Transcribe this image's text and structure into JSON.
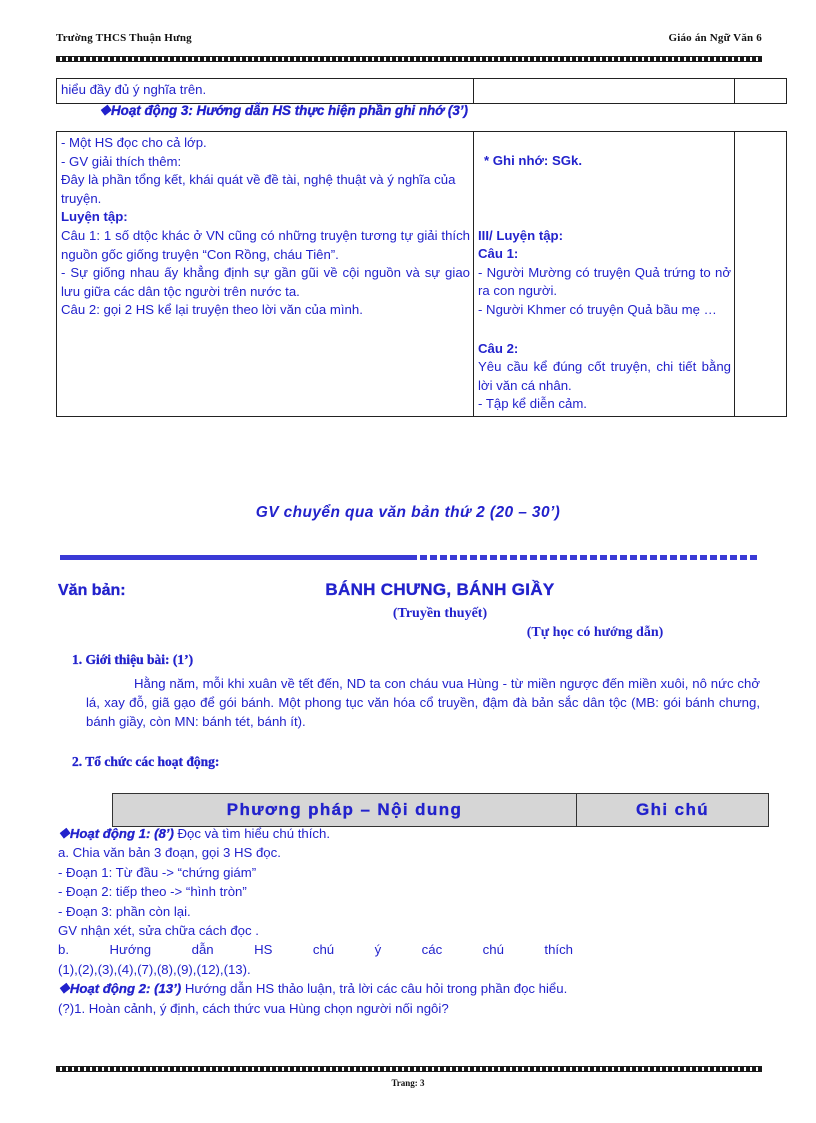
{
  "header": {
    "left": "Trường THCS Thuận Hưng",
    "right": "Giáo án Ngữ Văn 6"
  },
  "footer": {
    "page_label": "Trang: 3"
  },
  "colors": {
    "body_text": "#2222cc",
    "header_text": "#111111",
    "table_header_fill": "#d6d6d6",
    "divider_blue": "#3a3ad6",
    "border": "#222222"
  },
  "table_top": {
    "row": {
      "col1": "hiểu đầy đủ ý nghĩa trên.",
      "col2": "",
      "col3": ""
    }
  },
  "activity3_line": "❖Hoạt động 3: Hướng dẫn HS thực hiện phần ghi nhớ (3’)",
  "table_main": {
    "col1_lines": [
      "- Một HS đọc cho cả lớp.",
      "- GV giải thích thêm:",
      "Đây là phần tổng kết, khái quát về đề tài, nghệ thuật và ý nghĩa của truyện.",
      "Luyện tập:",
      "Câu 1: 1 số dtộc khác ở VN cũng có những truyện tương tự giải thích nguồn gốc giống truyện “Con Rồng, cháu Tiên”.",
      "- Sự giống nhau ấy khẳng định sự gần gũi về cội nguồn và sự giao lưu giữa các dân tộc người trên nước ta.",
      "Câu 2: gọi 2 HS kể lại truyện  theo lời văn của mình."
    ],
    "col1_line_flags": {
      "bold_index": 3
    },
    "col2_blocks": [
      {
        "text": "* Ghi nhớ: SGk.",
        "bold": true
      },
      {
        "text": "III/ Luyện tập:",
        "bold": true
      },
      {
        "text": "Câu 1:",
        "bold": true
      },
      {
        "text": "- Người Mường có truyện Quả trứng to nở ra con người.",
        "bold": false
      },
      {
        "text": "- Người Khmer có truyện Quả bầu mẹ …",
        "bold": false
      },
      {
        "text": "Câu 2:",
        "bold": true
      },
      {
        "text": "Yêu cầu kể đúng cốt truyện, chi tiết bằng lời văn cá nhân.",
        "bold": false
      },
      {
        "text": "- Tập kể diễn cảm.",
        "bold": false
      }
    ],
    "col3": ""
  },
  "transition_note": "GV chuyển qua văn bản thứ 2 (20 – 30’)",
  "title_block": {
    "label": "Văn bản:",
    "title": "BÁNH CHƯNG, BÁNH GIẦY",
    "genre": "(Truyền thuyết)",
    "mode": "(Tự học có hướng dẫn)"
  },
  "section1": {
    "heading": "1. Giới thiệu bài: (1’)",
    "body": "Hằng năm, mỗi khi xuân về tết đến, ND ta con cháu vua Hùng - từ miền ngược đến miền xuôi, nô nức chở lá, xay đỗ, giã gạo để gói bánh. Một phong tục văn hóa cổ truyền, đậm đà bản sắc dân tộc (MB: gói bánh chưng, bánh giầy, còn MN: bánh tét, bánh ít)."
  },
  "section2": {
    "heading": "2. Tổ chức các hoạt động:"
  },
  "lower_table": {
    "headers": [
      "Phương pháp – Nội dung",
      "Ghi chú"
    ]
  },
  "lower_body_lines": [
    {
      "lead": "❖Hoạt động 1: (8’)",
      "rest": " Đọc và tìm hiểu chú thích.",
      "justify": false
    },
    {
      "lead": "",
      "rest": "a. Chia văn bản 3 đoạn, gọi 3 HS đọc.",
      "justify": false
    },
    {
      "lead": "",
      "rest": "- Đoạn 1: Từ đầu -> “chứng giám”",
      "justify": false
    },
    {
      "lead": "",
      "rest": "- Đoạn 2: tiếp theo -> “hình tròn”",
      "justify": false
    },
    {
      "lead": "",
      "rest": "- Đoạn 3: phần còn lại.",
      "justify": false
    },
    {
      "lead": "",
      "rest": "GV nhận xét, sửa chữa cách đọc .",
      "justify": false
    },
    {
      "lead": "",
      "rest": "b.     Hướng     dẫn     HS     chú     ý     các     chú     thích",
      "justify": true
    },
    {
      "lead": "",
      "rest": "(1),(2),(3),(4),(7),(8),(9),(12),(13).",
      "justify": false
    },
    {
      "lead": "❖Hoạt động 2: (13’)",
      "rest": " Hướng dẫn HS thảo luận, trả lời các câu hỏi trong phần đọc hiểu.",
      "justify": false
    },
    {
      "lead": "",
      "rest": "(?)1. Hoàn cảnh, ý định, cách thức vua Hùng chọn người nối ngôi?",
      "justify": false
    }
  ]
}
